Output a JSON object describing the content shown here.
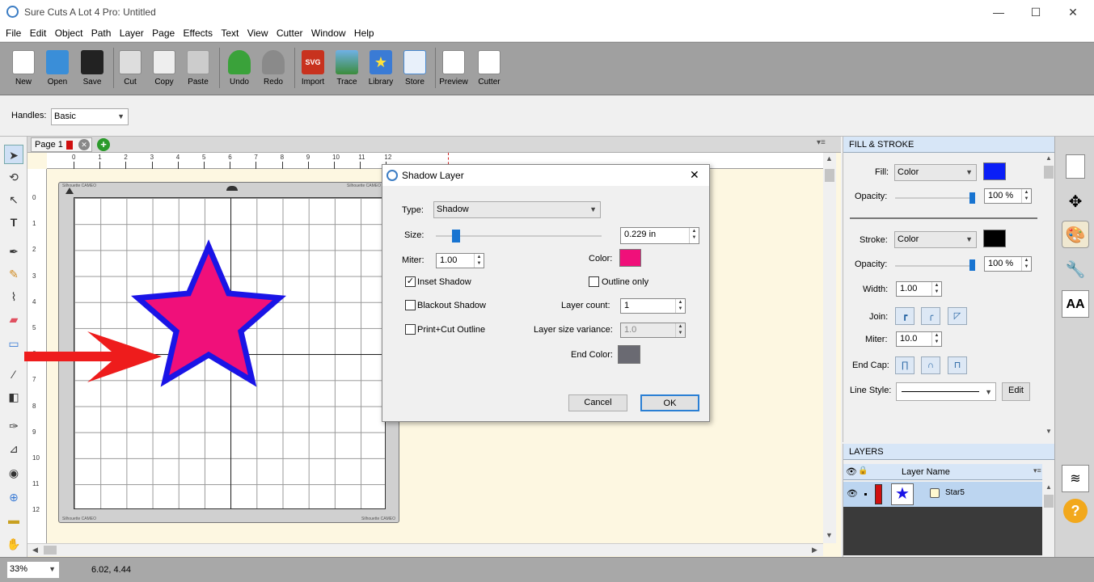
{
  "window": {
    "title": "Sure Cuts A Lot 4 Pro: Untitled",
    "minimize": "—",
    "maximize": "☐",
    "close": "✕"
  },
  "menu": [
    "File",
    "Edit",
    "Object",
    "Path",
    "Layer",
    "Page",
    "Effects",
    "Text",
    "View",
    "Cutter",
    "Window",
    "Help"
  ],
  "toolbar": [
    "New",
    "Open",
    "Save",
    "Cut",
    "Copy",
    "Paste",
    "Undo",
    "Redo",
    "Import",
    "Trace",
    "Library",
    "Store",
    "Preview",
    "Cutter"
  ],
  "import_badge": "SVG",
  "handles": {
    "label": "Handles:",
    "value": "Basic"
  },
  "page_tab": {
    "label": "Page 1"
  },
  "ruler": {
    "top": [
      "0",
      "1",
      "2",
      "3",
      "4",
      "5",
      "6",
      "7",
      "8",
      "9",
      "10",
      "11",
      "12"
    ],
    "left": [
      "0",
      "1",
      "2",
      "3",
      "4",
      "5",
      "6",
      "7",
      "8",
      "9",
      "10",
      "11",
      "12"
    ]
  },
  "mat": {
    "label_tl": "Silhouette CAMEO",
    "label_tr": "Silhouette CAMEO",
    "label_bl": "Silhouette CAMEO",
    "label_br": "Silhouette CAMEO"
  },
  "shadow_dialog": {
    "title": "Shadow Layer",
    "type_label": "Type:",
    "type_value": "Shadow",
    "size_label": "Size:",
    "size_value": "0.229 in",
    "size_level": 0.12,
    "miter_label": "Miter:",
    "miter_value": "1.00",
    "color_label": "Color:",
    "color": "#f0107a",
    "inset_shadow": "Inset Shadow",
    "inset_checked": true,
    "outline_only": "Outline only",
    "outline_checked": false,
    "blackout_shadow": "Blackout Shadow",
    "print_cut_outline": "Print+Cut Outline",
    "layer_count_label": "Layer count:",
    "layer_count_value": "1",
    "layer_variance_label": "Layer size variance:",
    "layer_variance_value": "1.0",
    "end_color_label": "End Color:",
    "end_color": "#6a6a72",
    "cancel": "Cancel",
    "ok": "OK"
  },
  "fill_stroke": {
    "header": "FILL & STROKE",
    "fill_label": "Fill:",
    "fill_type": "Color",
    "fill_color": "#0a1ef7",
    "opacity_label": "Opacity:",
    "fill_opacity": "100 %",
    "fill_opacity_level": 1.0,
    "stroke_label": "Stroke:",
    "stroke_type": "Color",
    "stroke_color": "#000000",
    "stroke_opacity_label": "Opacity:",
    "stroke_opacity": "100 %",
    "stroke_opacity_level": 1.0,
    "width_label": "Width:",
    "width_value": "1.00",
    "join_label": "Join:",
    "miter_label": "Miter:",
    "miter_value": "10.0",
    "endcap_label": "End Cap:",
    "linestyle_label": "Line Style:",
    "edit": "Edit"
  },
  "layers": {
    "header": "LAYERS",
    "column": "Layer Name",
    "layer_name": "Star5"
  },
  "status": {
    "zoom": "33%",
    "coords": "6.02, 4.44"
  },
  "colors": {
    "star_fill": "#f0107a",
    "star_stroke": "#1a14e6",
    "arrow": "#ee1c1c",
    "toolbar_bg": "#a0a0a0",
    "canvas_bg": "#fdf7e1"
  }
}
